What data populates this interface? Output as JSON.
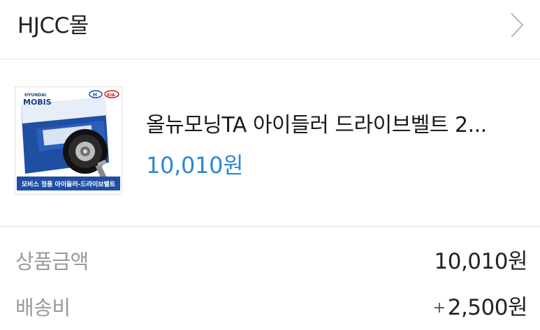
{
  "store": {
    "name": "HJCC몰",
    "chevron_icon": "chevron-right-icon"
  },
  "product": {
    "thumbnail": {
      "brand_top": "HYUNDAI",
      "brand": "MOBIS",
      "box_caption": "모비스 정품 아이들러-드라이브벨트"
    },
    "title": "올뉴모닝TA 아이들러 드라이브벨트 2...",
    "price": "10,010원",
    "price_color": "#2e86d8"
  },
  "summary": {
    "rows": [
      {
        "label": "상품금액",
        "prefix": "",
        "value": "10,010원"
      },
      {
        "label": "배송비",
        "prefix": "+",
        "value": "2,500원"
      }
    ]
  }
}
